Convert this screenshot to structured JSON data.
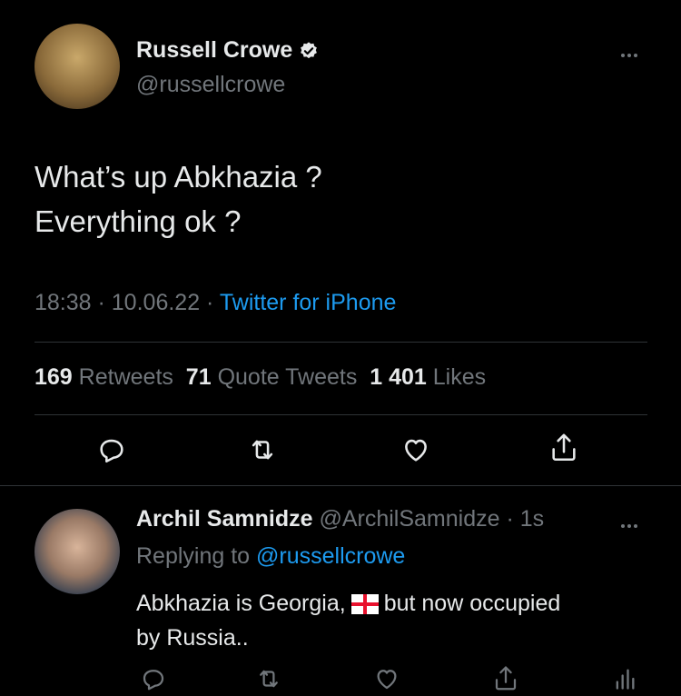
{
  "tweet": {
    "author_name": "Russell Crowe",
    "author_handle": "@russellcrowe",
    "text_line1": "What’s up Abkhazia ?",
    "text_line2": "Everything ok ?",
    "time": "18:38",
    "sep1": " · ",
    "date": "10.06.22",
    "sep2": " · ",
    "source": "Twitter for iPhone",
    "retweets_count": "169",
    "retweets_label": "Retweets",
    "quotes_count": "71",
    "quotes_label": "Quote Tweets",
    "likes_count": "1 401",
    "likes_label": "Likes"
  },
  "reply": {
    "author_name": "Archil Samnidze",
    "author_handle": "@ArchilSamnidze",
    "time": " · 1s",
    "replying_prefix": "Replying to ",
    "replying_to": "@russellcrowe",
    "text_part1": "Abkhazia is Georgia,",
    "text_part2": "but now occupied",
    "text_line2": "by Russia.."
  },
  "colors": {
    "background": "#000000",
    "text": "#e7e9ea",
    "muted": "#71767b",
    "link": "#1d9bf0",
    "divider": "#2f3336"
  },
  "icons": [
    "more-icon",
    "verified-badge-icon",
    "reply-icon",
    "retweet-icon",
    "like-icon",
    "share-icon",
    "analytics-icon",
    "georgia-flag-emoji"
  ]
}
